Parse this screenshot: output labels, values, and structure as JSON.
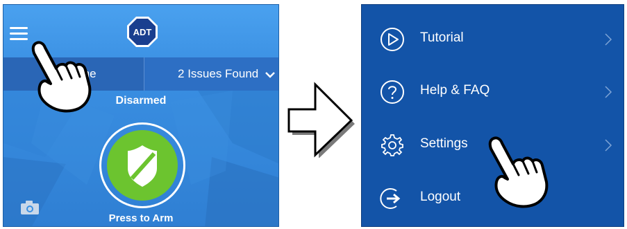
{
  "left_panel": {
    "logo_text": "ADT",
    "home_label": "me",
    "issues_label": "2 Issues Found",
    "status_text": "Disarmed",
    "arm_button_label": "Press to Arm",
    "colors": {
      "accent_green": "#6cc42f",
      "panel_blue": "#3a8fe2"
    }
  },
  "right_panel": {
    "menu": [
      {
        "label": "Tutorial",
        "icon": "play-circle-icon"
      },
      {
        "label": "Help & FAQ",
        "icon": "question-circle-icon"
      },
      {
        "label": "Settings",
        "icon": "gear-icon"
      },
      {
        "label": "Logout",
        "icon": "logout-icon"
      }
    ],
    "colors": {
      "background": "#1354a8"
    }
  }
}
